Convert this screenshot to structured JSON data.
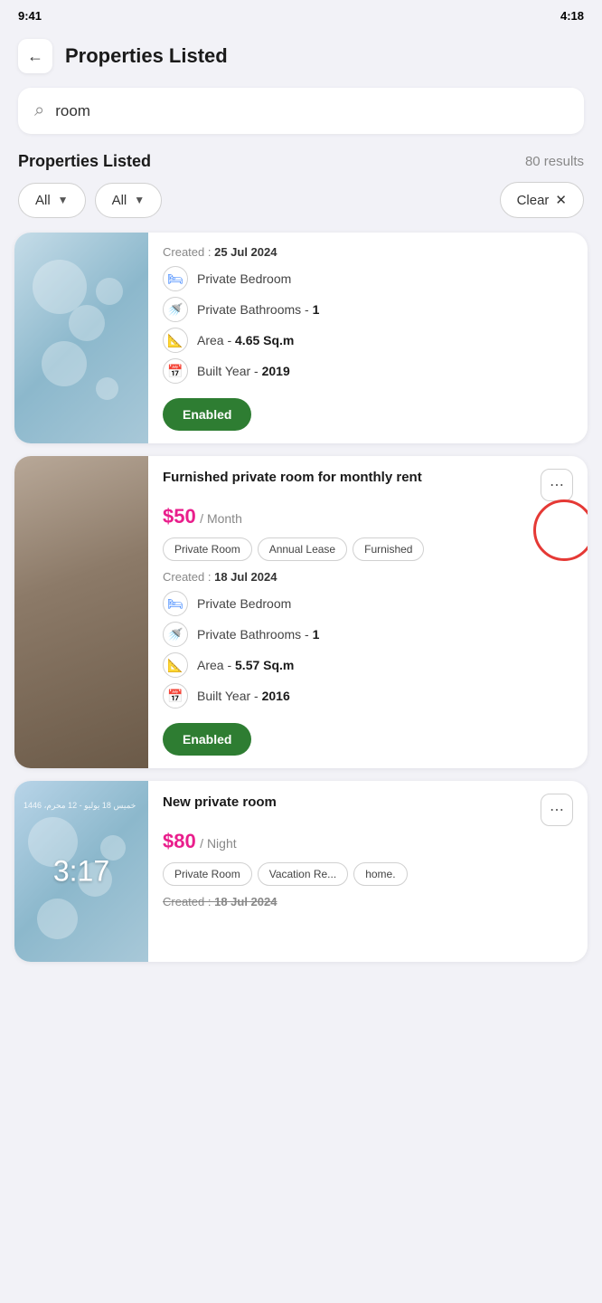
{
  "statusBar": {
    "left": "9:41",
    "right": "4:18"
  },
  "header": {
    "backLabel": "←",
    "title": "Properties Listed"
  },
  "search": {
    "placeholder": "room",
    "value": "room",
    "icon": "🔍"
  },
  "sectionTitle": "Properties Listed",
  "resultsCount": "80 results",
  "filters": {
    "filter1Label": "All",
    "filter2Label": "All",
    "clearLabel": "Clear",
    "clearIcon": "✕"
  },
  "properties": [
    {
      "id": 1,
      "hasTitle": false,
      "imageType": "room-img",
      "createdDate": "25 Jul 2024",
      "tags": [],
      "features": [
        {
          "iconType": "bed",
          "label": "Private Bedroom",
          "value": ""
        },
        {
          "iconType": "bath",
          "label": "Private Bathrooms",
          "value": "- 1"
        },
        {
          "iconType": "area",
          "label": "Area",
          "value": "- 4.65 Sq.m"
        },
        {
          "iconType": "calendar",
          "label": "Built Year",
          "value": "- 2019"
        }
      ],
      "status": "Enabled",
      "statusColor": "#2e7d32"
    },
    {
      "id": 2,
      "hasTitle": true,
      "title": "Furnished private room for monthly rent",
      "imageType": "curtain-img",
      "price": "$50",
      "pricePeriod": "/ Month",
      "tags": [
        "Private Room",
        "Annual Lease",
        "Furnished"
      ],
      "createdDate": "18 Jul 2024",
      "hasMoreBtn": true,
      "features": [
        {
          "iconType": "bed",
          "label": "Private Bedroom",
          "value": ""
        },
        {
          "iconType": "bath",
          "label": "Private Bathrooms",
          "value": "- 1"
        },
        {
          "iconType": "area",
          "label": "Area",
          "value": "- 5.57 Sq.m"
        },
        {
          "iconType": "calendar",
          "label": "Built Year",
          "value": "- 2016"
        }
      ],
      "status": "Enabled",
      "statusColor": "#2e7d32"
    },
    {
      "id": 3,
      "hasTitle": true,
      "title": "New private room",
      "imageType": "screen-img",
      "screenTime": "3:17",
      "screenDate": "خمیس 18 یولیو - 12 محرم، 1446",
      "price": "$80",
      "pricePeriod": "/ Night",
      "tags": [
        "Private Room",
        "Vacation Re...",
        "home."
      ],
      "createdDate": "18 Jul 2024",
      "hasMoreBtn": true,
      "createdStrikethrough": true,
      "features": []
    }
  ]
}
